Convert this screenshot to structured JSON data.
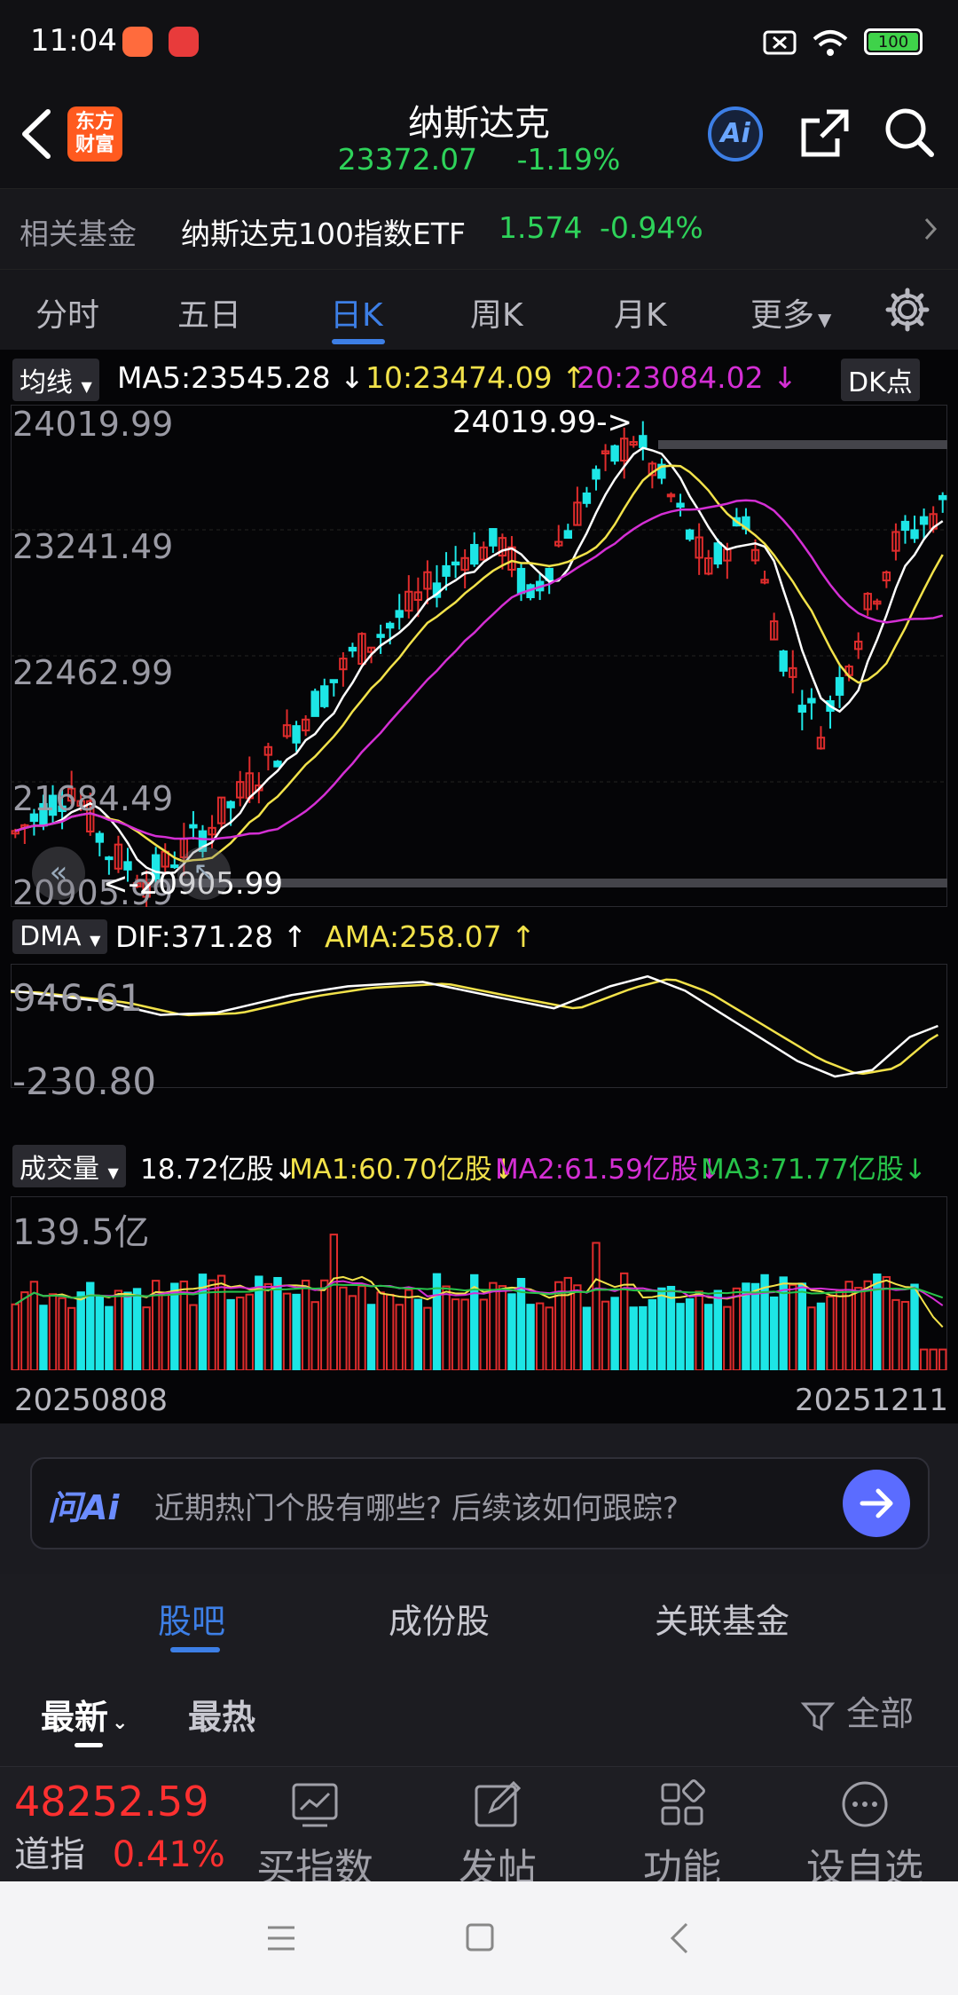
{
  "status_bar": {
    "time": "11:04",
    "battery": "100"
  },
  "header": {
    "title": "纳斯达克",
    "price": "23372.07",
    "change": "-1.19%",
    "logo_line1": "东方",
    "logo_line2": "财富",
    "ai_label": "Ai"
  },
  "fund_row": {
    "label": "相关基金",
    "name": "纳斯达克100指数ETF",
    "price": "1.574",
    "change": "-0.94%"
  },
  "period_tabs": [
    {
      "label": "分时"
    },
    {
      "label": "五日"
    },
    {
      "label": "日K"
    },
    {
      "label": "周K"
    },
    {
      "label": "月K"
    },
    {
      "label": "更多"
    }
  ],
  "ma_row": {
    "selector": "均线",
    "ma5": "MA5:23545.28",
    "ma10": "10:23474.09",
    "ma20": "20:23084.02",
    "dk": "DK点"
  },
  "price_axis": [
    "24019.99",
    "23241.49",
    "22462.99",
    "21684.49",
    "20905.99"
  ],
  "high_marker": "24019.99->",
  "low_marker": "<-20905.99",
  "dma_row": {
    "selector": "DMA",
    "dif": "DIF:371.28",
    "ama": "AMA:258.07"
  },
  "dma_axis": [
    "946.61",
    "-230.80"
  ],
  "vol_row": {
    "selector": "成交量",
    "vol": "18.72亿股",
    "ma1": "MA1:60.70亿股",
    "ma2": "MA2:61.59亿股",
    "ma3": "MA3:71.77亿股"
  },
  "vol_axis": "139.5亿",
  "date_start": "20250808",
  "date_end": "20251211",
  "ask_ai": {
    "brand": "问Ai",
    "prompt": "近期热门个股有哪些? 后续该如何跟踪?"
  },
  "lower_tabs": [
    {
      "label": "股吧"
    },
    {
      "label": "成份股"
    },
    {
      "label": "关联基金"
    }
  ],
  "filter": {
    "latest": "最新",
    "hot": "最热",
    "all": "全部"
  },
  "bottom_bar": {
    "ticker_value": "48252.59",
    "ticker_name": "道指",
    "ticker_change": "0.41%",
    "items": [
      {
        "label": "买指数"
      },
      {
        "label": "发帖"
      },
      {
        "label": "功能"
      },
      {
        "label": "设自选"
      }
    ]
  },
  "colors": {
    "up": "#e02c2c",
    "down": "#1de6e6",
    "ma5": "#ffffff",
    "ma10": "#f2e24a",
    "ma20": "#d42fd4",
    "ma3_vol": "#27c44a",
    "accent": "#3d7fe6"
  },
  "chart_data": {
    "type": "candlestick",
    "price_range": [
      20905.99,
      24019.99
    ],
    "high": 24019.99,
    "low": 20905.99,
    "latest_ma": {
      "MA5": 23545.28,
      "MA10": 23474.09,
      "MA20": 23084.02
    },
    "dma": {
      "DIF": 371.28,
      "AMA": 258.07,
      "range": [
        -230.8,
        946.61
      ]
    },
    "volume": {
      "latest": "18.72亿股",
      "MA1": "60.70亿股",
      "MA2": "61.59亿股",
      "MA3": "71.77亿股",
      "max": "139.5亿"
    },
    "date_range": [
      "20250808",
      "20251211"
    ]
  }
}
